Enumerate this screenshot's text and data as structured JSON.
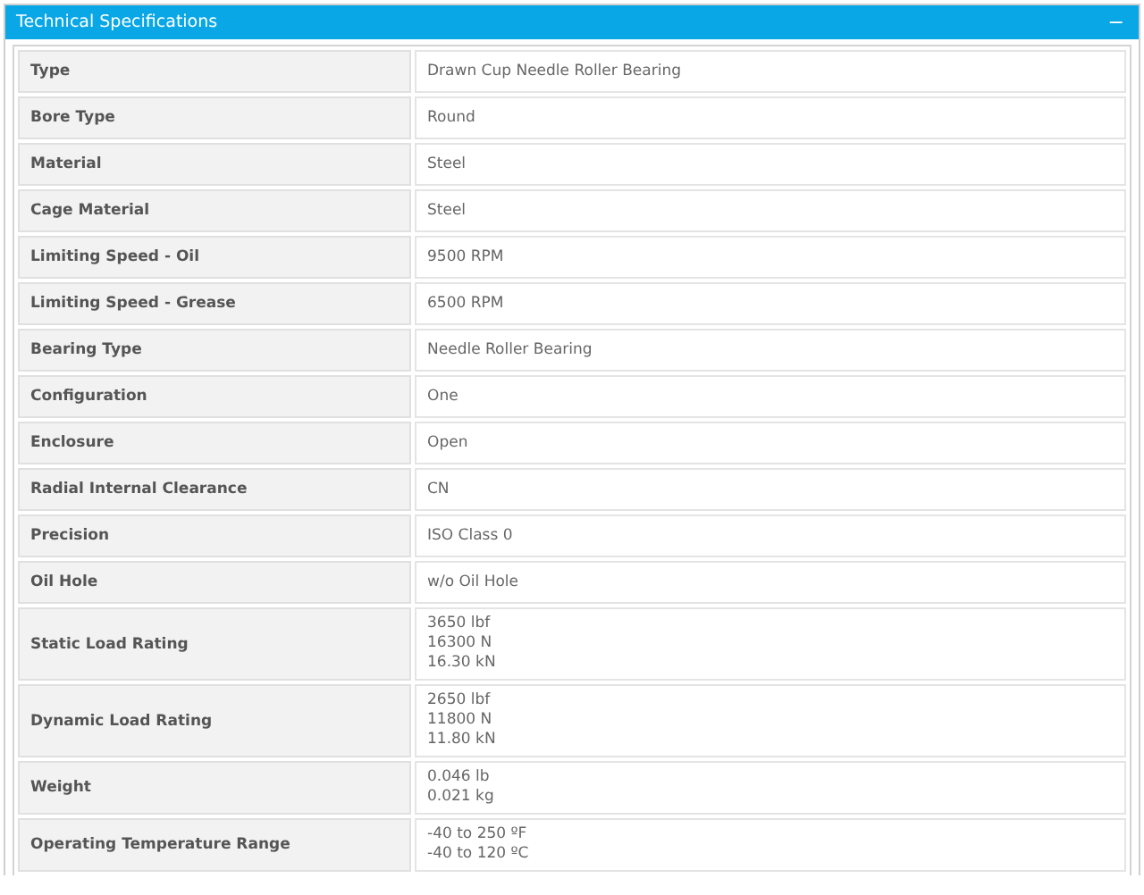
{
  "panel": {
    "title": "Technical Specifications",
    "toggle": "−"
  },
  "rows": [
    {
      "label": "Type",
      "values": [
        "Drawn Cup Needle Roller Bearing"
      ]
    },
    {
      "label": "Bore Type",
      "values": [
        "Round"
      ]
    },
    {
      "label": "Material",
      "values": [
        "Steel"
      ]
    },
    {
      "label": "Cage Material",
      "values": [
        "Steel"
      ]
    },
    {
      "label": "Limiting Speed - Oil",
      "values": [
        "9500 RPM"
      ]
    },
    {
      "label": "Limiting Speed - Grease",
      "values": [
        "6500 RPM"
      ]
    },
    {
      "label": "Bearing Type",
      "values": [
        "Needle Roller Bearing"
      ]
    },
    {
      "label": "Configuration",
      "values": [
        "One"
      ]
    },
    {
      "label": "Enclosure",
      "values": [
        "Open"
      ]
    },
    {
      "label": "Radial Internal Clearance",
      "values": [
        "CN"
      ]
    },
    {
      "label": "Precision",
      "values": [
        "ISO Class 0"
      ]
    },
    {
      "label": "Oil Hole",
      "values": [
        "w/o Oil Hole"
      ]
    },
    {
      "label": "Static Load Rating",
      "values": [
        "3650 lbf",
        "16300 N",
        "16.30 kN"
      ]
    },
    {
      "label": "Dynamic Load Rating",
      "values": [
        "2650 lbf",
        "11800 N",
        "11.80 kN"
      ]
    },
    {
      "label": "Weight",
      "values": [
        "0.046 lb",
        "0.021 kg"
      ]
    },
    {
      "label": "Operating Temperature Range",
      "values": [
        "-40 to 250 ºF",
        "-40 to 120 ºC"
      ]
    }
  ]
}
